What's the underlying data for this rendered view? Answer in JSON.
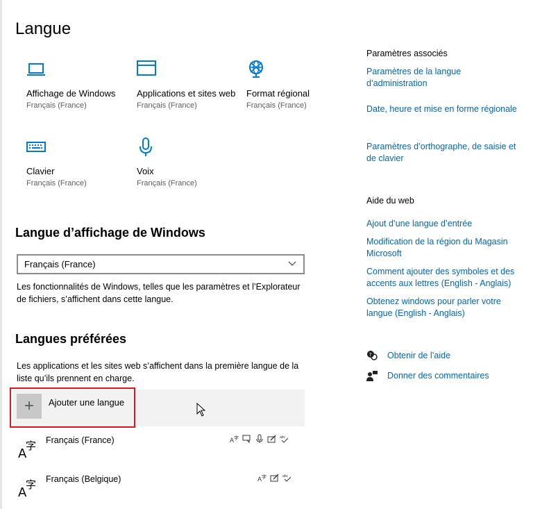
{
  "page": {
    "title": "Langue"
  },
  "tiles": [
    {
      "title": "Affichage de Windows",
      "subtitle": "Français (France)",
      "icon": "laptop-icon"
    },
    {
      "title": "Applications et sites web",
      "subtitle": "Français (France)",
      "icon": "window-icon"
    },
    {
      "title": "Format régional",
      "subtitle": "Français (France)",
      "icon": "globe-icon"
    },
    {
      "title": "Clavier",
      "subtitle": "Français (France)",
      "icon": "keyboard-icon"
    },
    {
      "title": "Voix",
      "subtitle": "Français (France)",
      "icon": "microphone-icon"
    }
  ],
  "display_language": {
    "heading": "Langue d’affichage de Windows",
    "selected": "Français (France)",
    "description": "Les fonctionnalités de Windows, telles que les paramètres et l’Explorateur de fichiers, s’affichent dans cette langue."
  },
  "preferred": {
    "heading": "Langues préférées",
    "description": "Les applications et les sites web s’affichent dans la première langue de la liste qu’ils prennent en charge.",
    "add_label": "Ajouter une langue",
    "add_symbol": "+",
    "languages": [
      {
        "name": "Français (France)"
      },
      {
        "name": "Français (Belgique)"
      }
    ]
  },
  "sidebar": {
    "related_heading": "Paramètres associés",
    "related_links": [
      "Paramètres de la langue d’administration",
      "Date, heure et mise en forme régionale",
      "Paramètres d’orthographe, de saisie et de clavier"
    ],
    "web_heading": "Aide du web",
    "web_links": [
      "Ajout d’une langue d’entrée",
      "Modification de la région du Magasin Microsoft",
      "Comment ajouter des symboles et des accents aux lettres (English - Anglais)",
      "Obtenez windows pour parler votre langue (English - Anglais)"
    ],
    "help": {
      "get_help": "Obtenir de l’aide",
      "feedback": "Donner des commentaires"
    }
  },
  "colors": {
    "accent": "#0078d4",
    "link": "#0066b4",
    "highlight_box": "#e3141b"
  }
}
